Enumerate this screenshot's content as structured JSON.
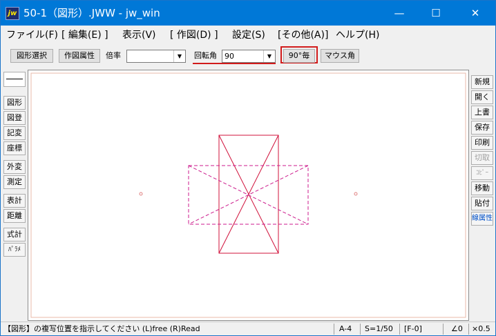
{
  "window": {
    "app_icon": "jw",
    "title": "50-1（図形）.JWW - jw_win",
    "minimize_glyph": "—",
    "maximize_glyph": "☐",
    "close_glyph": "✕"
  },
  "menu": {
    "items": [
      "ファイル(F)",
      "[ 編集(E) ]",
      "表示(V)",
      "[ 作図(D) ]",
      "設定(S)",
      "[その他(A)]",
      "ヘルプ(H)"
    ]
  },
  "toolbar": {
    "figure_select": "図形選択",
    "draw_attr": "作図属性",
    "scale_label": "倍率",
    "scale_value": "",
    "rotation_label": "回転角",
    "rotation_value": "90",
    "rotate90_button": "90°毎",
    "mouse_angle_button": "マウス角",
    "dropdown_glyph": "▼"
  },
  "left_toolbar": {
    "items": [
      "図形",
      "図登",
      "記変",
      "座標",
      "外変",
      "測定",
      "表計",
      "距離",
      "式計",
      "ﾊﾟﾗﾒ"
    ]
  },
  "right_toolbar": {
    "items": [
      "新規",
      "開く",
      "上書",
      "保存",
      "印刷",
      "切取",
      "ｺﾋﾟｰ",
      "移動",
      "貼付",
      "線属性"
    ]
  },
  "status": {
    "message": "【図形】の複写位置を指示してください (L)free (R)Read",
    "paper": "A-4",
    "scale": "S=1/50",
    "layer": "[F-0]",
    "angle": "∠0",
    "zoom": "×0.5"
  },
  "colors": {
    "titlebar": "#0078d7",
    "highlight_red": "#d11a1a",
    "solid_figure": "#d0103a",
    "dashed_figure": "#cc1a8c",
    "reference_point": "#e08080",
    "canvas_border": "#e8b8a8"
  }
}
